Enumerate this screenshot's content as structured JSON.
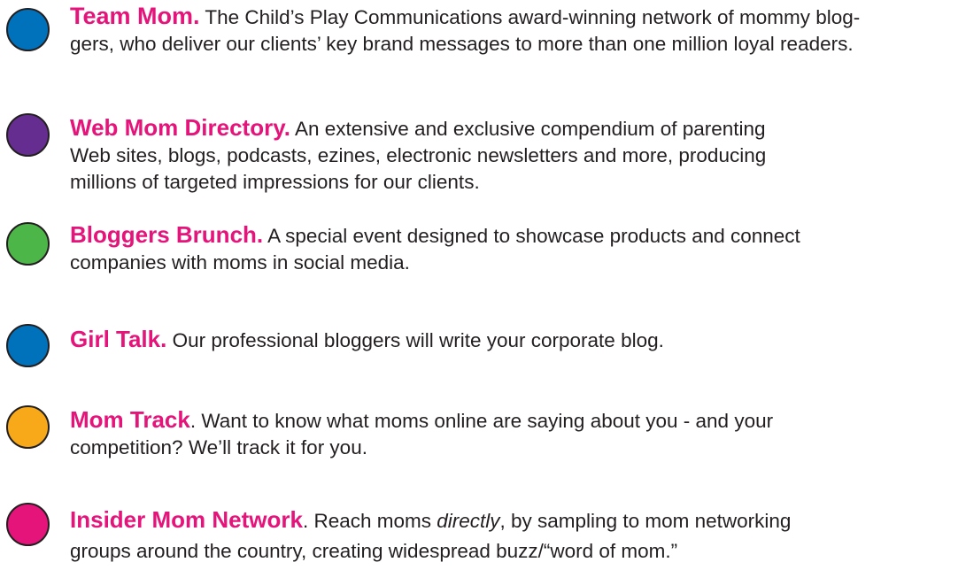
{
  "items": [
    {
      "title": "Team Mom.",
      "line1": " The Child’s Play Communications award-winning network of mommy blog-",
      "line2": "gers, who deliver our clients’ key brand messages to more than one million loyal readers.",
      "color": "#0072bc"
    },
    {
      "title": "Web Mom Directory.",
      "line1": " An extensive and exclusive compendium of parenting",
      "line2": "Web sites, blogs, podcasts, ezines, electronic newsletters and more, producing",
      "line3": "millions of targeted impressions for our clients.",
      "color": "#662d91"
    },
    {
      "title": "Bloggers Brunch.",
      "line1": " A special event designed to showcase products and connect",
      "line2": "companies with moms in social media.",
      "color": "#4cb748"
    },
    {
      "title": "Girl Talk.",
      "line1": " Our professional bloggers will write your corporate blog.",
      "color": "#0072bc"
    },
    {
      "title": "Mom Track",
      "line1": ". Want to know what moms online are saying about you - and your",
      "line2": "competition? We’ll track it for you.",
      "color": "#f8a91a"
    },
    {
      "title": "Insider Mom Network",
      "line1_pre": ". Reach moms ",
      "line1_em": "directly",
      "line1_post": ", by sampling to mom networking",
      "line2": "groups around the country, creating widespread buzz/“word of mom.”",
      "color": "#e5147a"
    }
  ],
  "title_color": "#e5147a",
  "text_color": "#231f20"
}
